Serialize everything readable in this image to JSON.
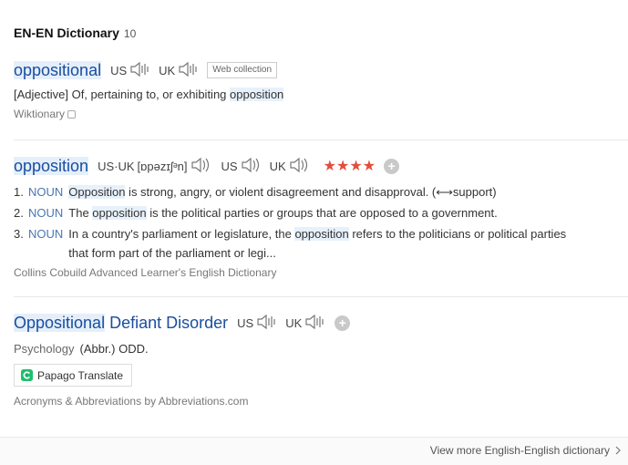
{
  "header": {
    "title": "EN-EN Dictionary",
    "count": "10"
  },
  "entries": [
    {
      "word": "oppositional",
      "us": "US",
      "uk": "UK",
      "badge": "Web collection",
      "definition": {
        "prefix": "[Adjective] Of, pertaining to, or exhibiting ",
        "highlight": "opposition"
      },
      "source": "Wiktionary"
    },
    {
      "word": "opposition",
      "pron_label": "US·UK",
      "pron": "[ɒpəzɪʃᵊn]",
      "us": "US",
      "uk": "UK",
      "stars": "★★★★",
      "senses": [
        {
          "num": "1.",
          "pos": "NOUN",
          "hl": "Opposition",
          "rest": " is strong, angry, or violent disagreement and disapproval. (⟷support)"
        },
        {
          "num": "2.",
          "pos": "NOUN",
          "pre": "The ",
          "hl": "opposition",
          "rest": " is the political parties or groups that are opposed to a government."
        },
        {
          "num": "3.",
          "pos": "NOUN",
          "pre": "In a country's parliament or legislature, the ",
          "hl": "opposition",
          "rest": " refers to the politicians or political parties",
          "line2": "that form part of the parliament or legi..."
        }
      ],
      "source": "Collins Cobuild Advanced Learner's English Dictionary"
    },
    {
      "word_hl": "Oppositional",
      "word_rest": " Defiant Disorder",
      "us": "US",
      "uk": "UK",
      "category": "Psychology",
      "definition": "(Abbr.) ODD.",
      "papago": "Papago Translate",
      "source": "Acronyms & Abbreviations by Abbreviations.com"
    }
  ],
  "footer": {
    "more": "View more English-English dictionary"
  },
  "colors": {
    "link": "#1a4ea0",
    "highlight": "#e7f1fb",
    "stars": "#e34d3c",
    "pos": "#4a76b5"
  }
}
